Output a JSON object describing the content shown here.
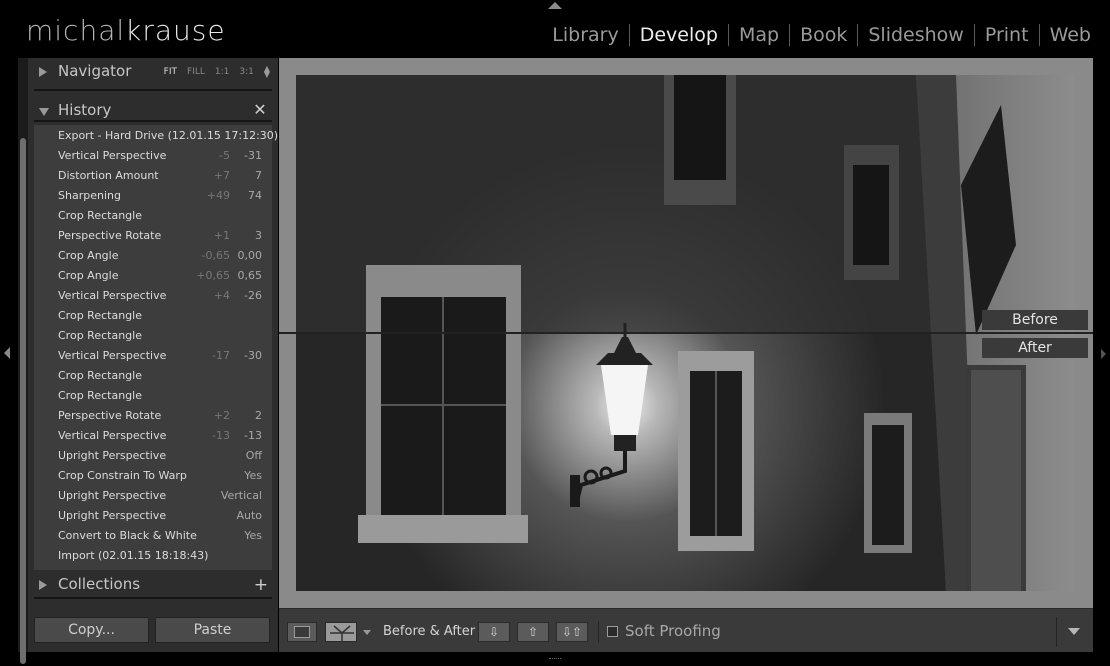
{
  "logo": {
    "part1": "michal",
    "part2": "krause"
  },
  "modules": [
    {
      "label": "Library",
      "active": false
    },
    {
      "label": "Develop",
      "active": true
    },
    {
      "label": "Map",
      "active": false
    },
    {
      "label": "Book",
      "active": false
    },
    {
      "label": "Slideshow",
      "active": false
    },
    {
      "label": "Print",
      "active": false
    },
    {
      "label": "Web",
      "active": false
    }
  ],
  "navigator": {
    "title": "Navigator",
    "options": [
      "FIT",
      "FILL",
      "1:1",
      "3:1"
    ],
    "selected": "FIT"
  },
  "history": {
    "title": "History",
    "close_icon": "close-icon",
    "items": [
      {
        "name": "Export - Hard Drive (12.01.15 17:12:30)",
        "v1": "",
        "v2": ""
      },
      {
        "name": "Vertical Perspective",
        "v1": "-5",
        "v2": "-31"
      },
      {
        "name": "Distortion Amount",
        "v1": "+7",
        "v2": "7"
      },
      {
        "name": "Sharpening",
        "v1": "+49",
        "v2": "74"
      },
      {
        "name": "Crop Rectangle",
        "v1": "",
        "v2": ""
      },
      {
        "name": "Perspective Rotate",
        "v1": "+1",
        "v2": "3"
      },
      {
        "name": "Crop Angle",
        "v1": "-0,65",
        "v2": "0,00"
      },
      {
        "name": "Crop Angle",
        "v1": "+0,65",
        "v2": "0,65"
      },
      {
        "name": "Vertical Perspective",
        "v1": "+4",
        "v2": "-26"
      },
      {
        "name": "Crop Rectangle",
        "v1": "",
        "v2": ""
      },
      {
        "name": "Crop Rectangle",
        "v1": "",
        "v2": ""
      },
      {
        "name": "Vertical Perspective",
        "v1": "-17",
        "v2": "-30"
      },
      {
        "name": "Crop Rectangle",
        "v1": "",
        "v2": ""
      },
      {
        "name": "Crop Rectangle",
        "v1": "",
        "v2": ""
      },
      {
        "name": "Perspective Rotate",
        "v1": "+2",
        "v2": "2"
      },
      {
        "name": "Vertical Perspective",
        "v1": "-13",
        "v2": "-13"
      },
      {
        "name": "Upright Perspective",
        "v1": "",
        "v2": "Off"
      },
      {
        "name": "Crop Constrain To Warp",
        "v1": "",
        "v2": "Yes"
      },
      {
        "name": "Upright Perspective",
        "v1": "",
        "v2": "Vertical"
      },
      {
        "name": "Upright Perspective",
        "v1": "",
        "v2": "Auto"
      },
      {
        "name": "Convert to Black & White",
        "v1": "",
        "v2": "Yes"
      },
      {
        "name": "Import (02.01.15 18:18:43)",
        "v1": "",
        "v2": ""
      }
    ]
  },
  "collections": {
    "title": "Collections",
    "add_icon": "plus-icon"
  },
  "buttons": {
    "copy": "Copy...",
    "paste": "Paste"
  },
  "viewer": {
    "before_label": "Before",
    "after_label": "After"
  },
  "toolbar": {
    "before_after_label": "Before & After :",
    "soft_proofing_label": "Soft Proofing",
    "soft_proofing_checked": false
  }
}
